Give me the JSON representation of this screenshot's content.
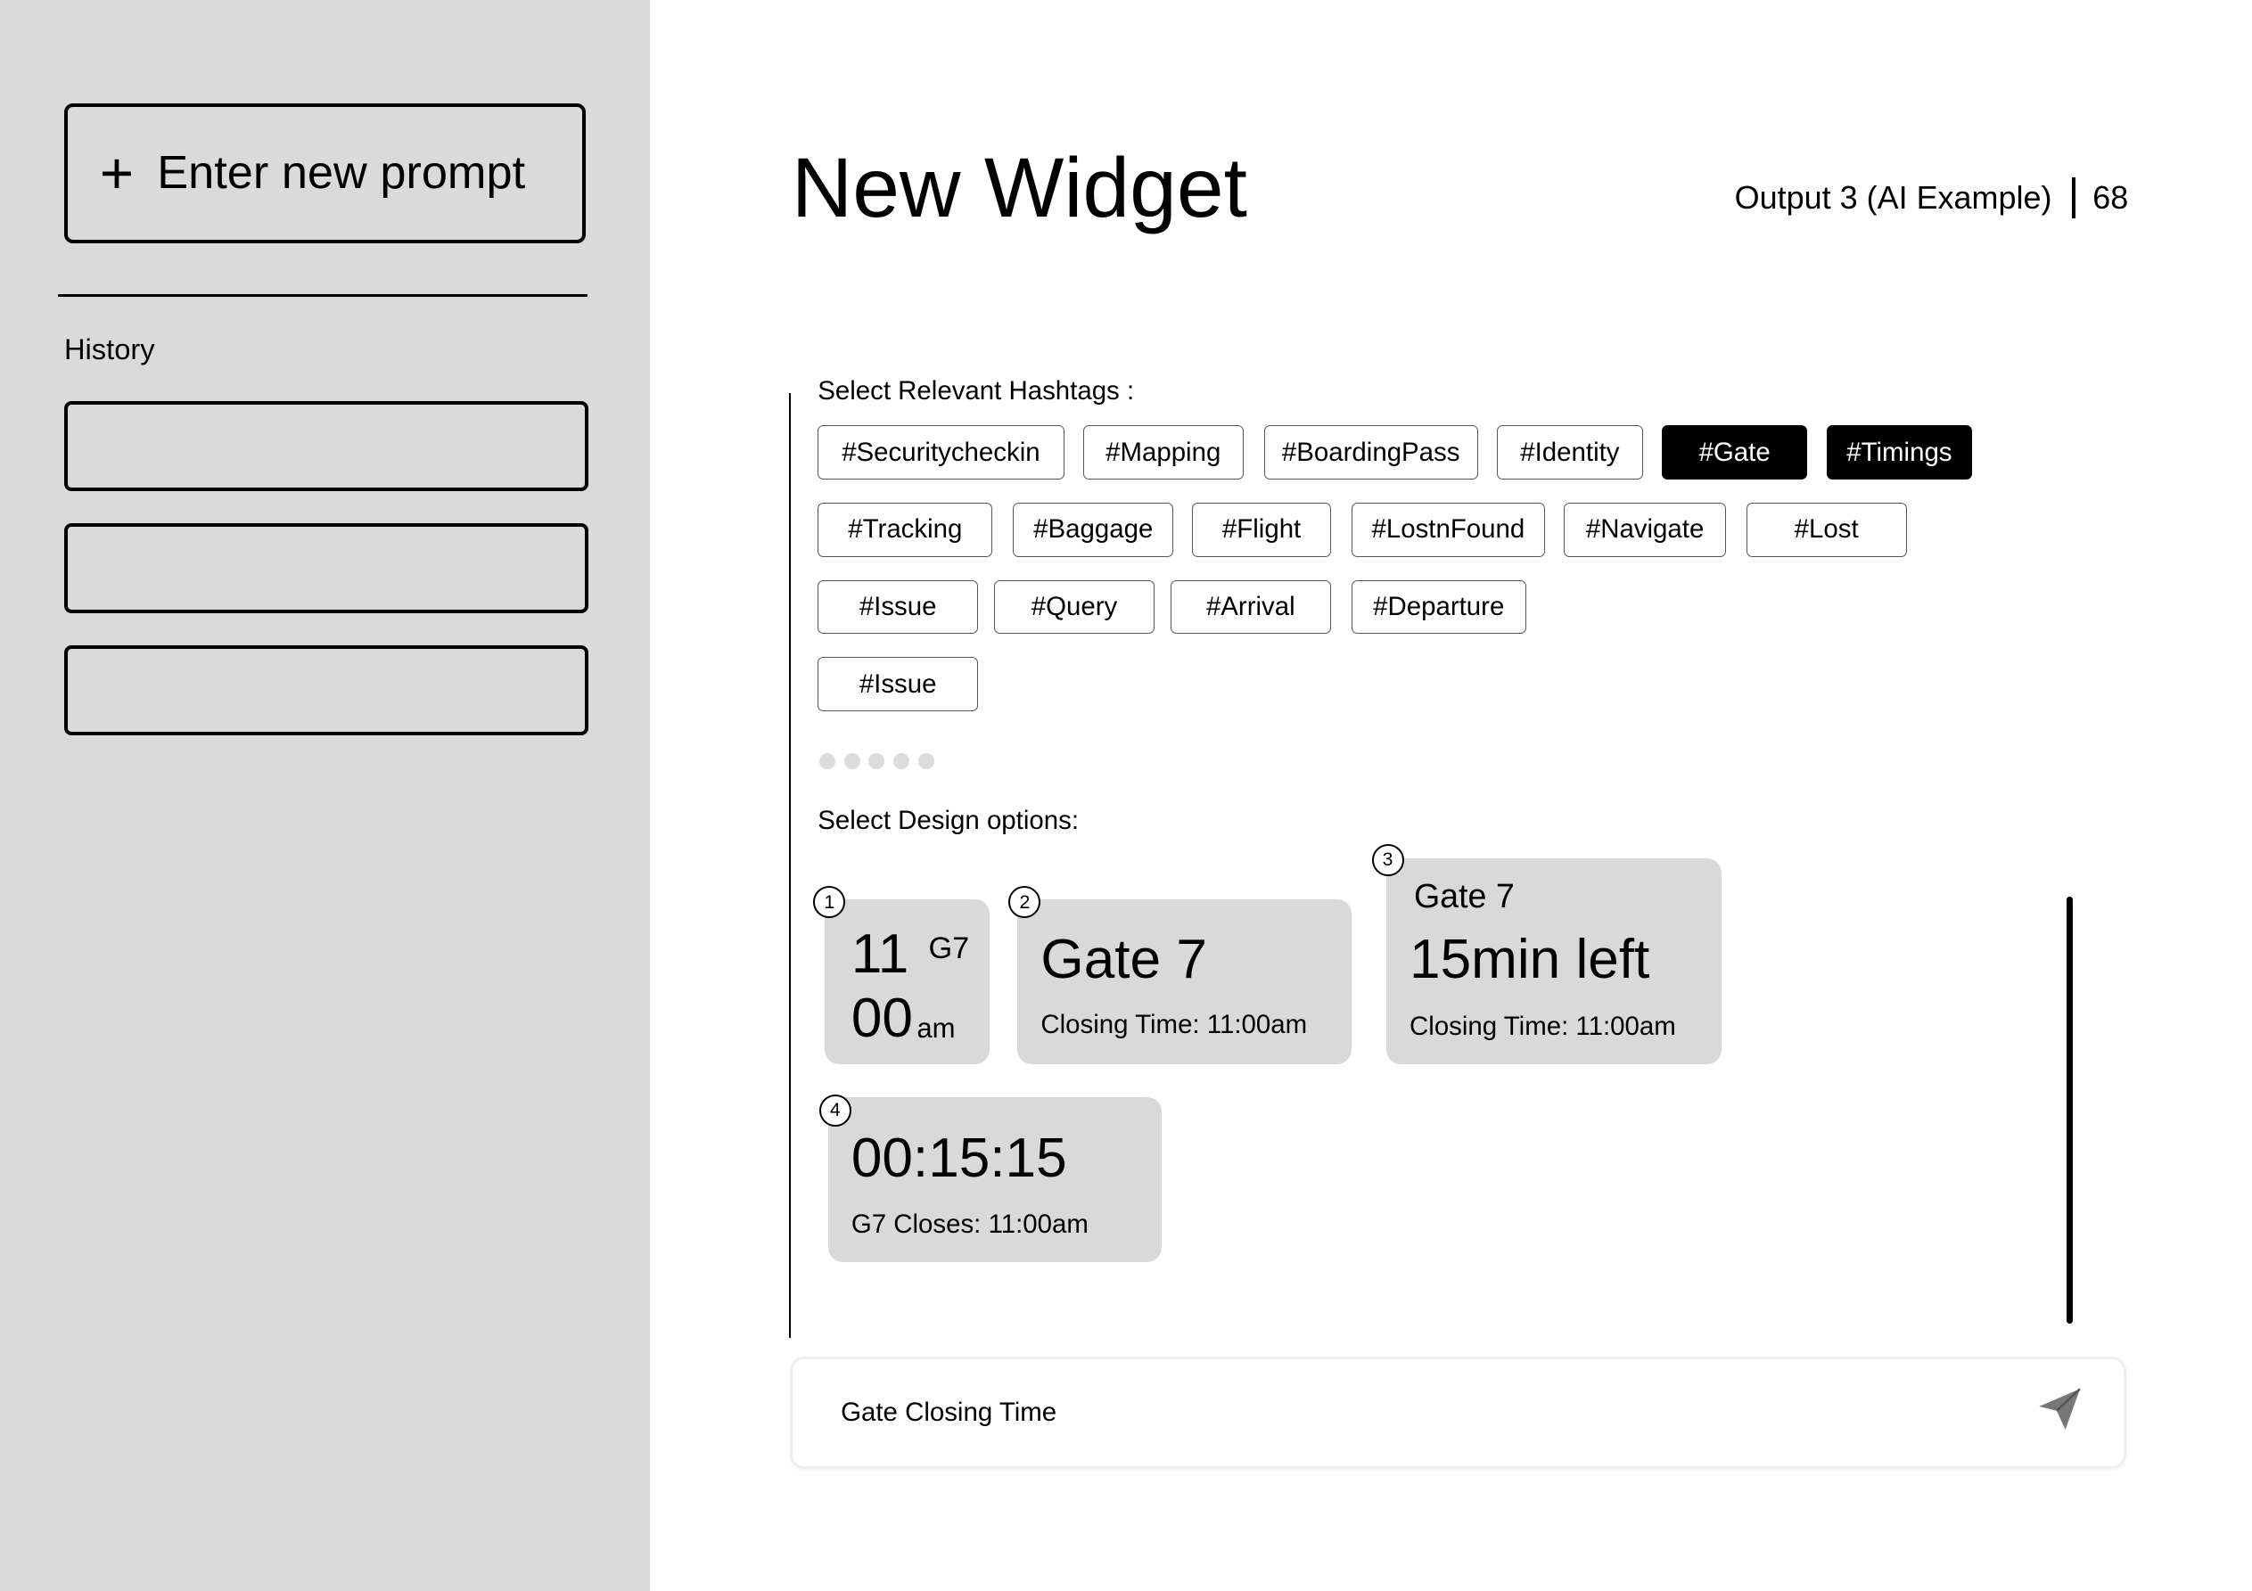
{
  "sidebar": {
    "new_prompt_label": "Enter new prompt",
    "plus_icon": "+",
    "history_label": "History",
    "history_items": [
      "",
      "",
      ""
    ]
  },
  "header": {
    "title": "New Widget",
    "output_label": "Output 3 (AI Example)",
    "count": "68"
  },
  "hashtags": {
    "label": "Select Relevant Hashtags :",
    "items": [
      {
        "label": "#Securitycheckin",
        "selected": false
      },
      {
        "label": "#Mapping",
        "selected": false
      },
      {
        "label": "#BoardingPass",
        "selected": false
      },
      {
        "label": "#Identity",
        "selected": false
      },
      {
        "label": "#Gate",
        "selected": true
      },
      {
        "label": "#Timings",
        "selected": true
      },
      {
        "label": "#Tracking",
        "selected": false
      },
      {
        "label": "#Baggage",
        "selected": false
      },
      {
        "label": "#Flight",
        "selected": false
      },
      {
        "label": "#LostnFound",
        "selected": false
      },
      {
        "label": "#Navigate",
        "selected": false
      },
      {
        "label": "#Lost",
        "selected": false
      },
      {
        "label": "#Issue",
        "selected": false
      },
      {
        "label": "#Query",
        "selected": false
      },
      {
        "label": "#Arrival",
        "selected": false
      },
      {
        "label": "#Departure",
        "selected": false
      },
      {
        "label": "#Issue",
        "selected": false
      }
    ]
  },
  "design": {
    "label": "Select Design options:",
    "options": [
      {
        "number": "1",
        "hour": "11",
        "gate": "G7",
        "minute": "00",
        "suffix": "am"
      },
      {
        "number": "2",
        "title": "Gate 7",
        "subtitle": "Closing Time: 11:00am"
      },
      {
        "number": "3",
        "gate": "Gate 7",
        "title": "15min left",
        "subtitle": "Closing Time: 11:00am"
      },
      {
        "number": "4",
        "title": "00:15:15",
        "subtitle": "G7 Closes: 11:00am"
      }
    ]
  },
  "prompt_input": {
    "value": "Gate Closing Time",
    "send_icon": "send-icon"
  },
  "colors": {
    "sidebar_bg": "#dadada",
    "card_bg": "#d9d9d9",
    "selected_chip": "#000000"
  }
}
